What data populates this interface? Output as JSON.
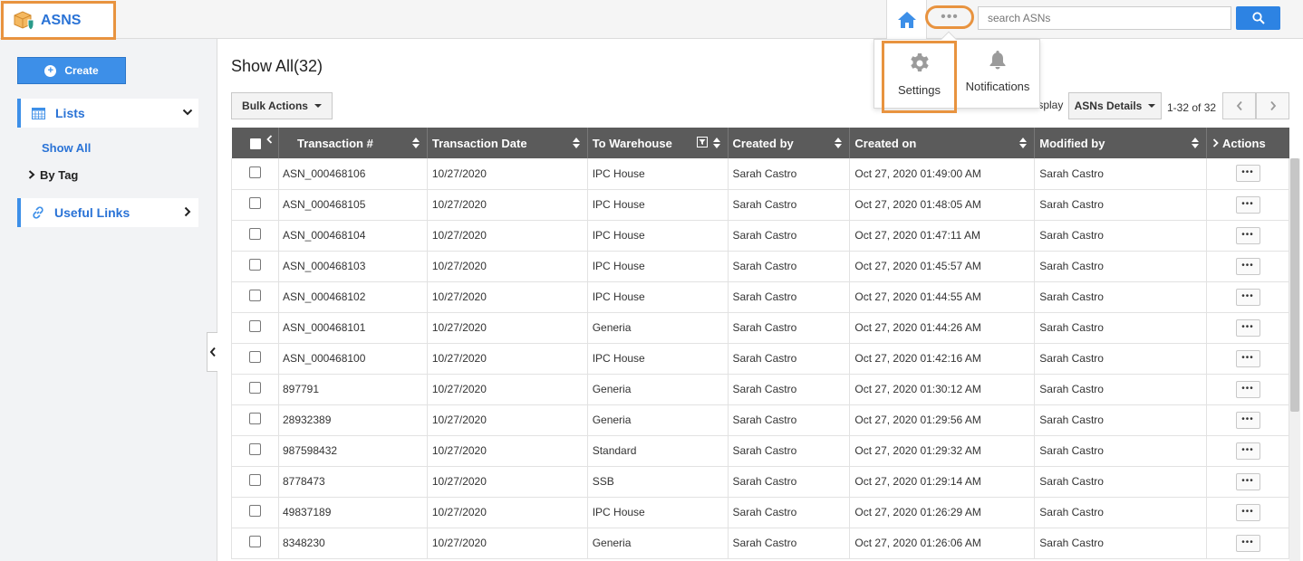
{
  "app": {
    "title": "ASNS"
  },
  "header": {
    "search_placeholder": "search ASNs",
    "more_label": "•••",
    "menu": {
      "settings": "Settings",
      "notifications": "Notifications"
    }
  },
  "sidebar": {
    "create_label": "Create",
    "lists_label": "Lists",
    "show_all_label": "Show All",
    "by_tag_label": "By Tag",
    "useful_links_label": "Useful Links"
  },
  "main": {
    "title": "Show All(32)",
    "bulk_actions_label": "Bulk Actions",
    "display_label": "Display",
    "display_value": "ASNs Details",
    "pager_text": "1-32 of 32"
  },
  "table": {
    "columns": [
      "Transaction #",
      "Transaction Date",
      "To Warehouse",
      "Created by",
      "Created on",
      "Modified by",
      "Actions"
    ],
    "rows": [
      [
        "ASN_000468106",
        "10/27/2020",
        "IPC House",
        "Sarah Castro",
        "Oct 27, 2020 01:49:00 AM",
        "Sarah Castro"
      ],
      [
        "ASN_000468105",
        "10/27/2020",
        "IPC House",
        "Sarah Castro",
        "Oct 27, 2020 01:48:05 AM",
        "Sarah Castro"
      ],
      [
        "ASN_000468104",
        "10/27/2020",
        "IPC House",
        "Sarah Castro",
        "Oct 27, 2020 01:47:11 AM",
        "Sarah Castro"
      ],
      [
        "ASN_000468103",
        "10/27/2020",
        "IPC House",
        "Sarah Castro",
        "Oct 27, 2020 01:45:57 AM",
        "Sarah Castro"
      ],
      [
        "ASN_000468102",
        "10/27/2020",
        "IPC House",
        "Sarah Castro",
        "Oct 27, 2020 01:44:55 AM",
        "Sarah Castro"
      ],
      [
        "ASN_000468101",
        "10/27/2020",
        "Generia",
        "Sarah Castro",
        "Oct 27, 2020 01:44:26 AM",
        "Sarah Castro"
      ],
      [
        "ASN_000468100",
        "10/27/2020",
        "IPC House",
        "Sarah Castro",
        "Oct 27, 2020 01:42:16 AM",
        "Sarah Castro"
      ],
      [
        "897791",
        "10/27/2020",
        "Generia",
        "Sarah Castro",
        "Oct 27, 2020 01:30:12 AM",
        "Sarah Castro"
      ],
      [
        "28932389",
        "10/27/2020",
        "Generia",
        "Sarah Castro",
        "Oct 27, 2020 01:29:56 AM",
        "Sarah Castro"
      ],
      [
        "987598432",
        "10/27/2020",
        "Standard",
        "Sarah Castro",
        "Oct 27, 2020 01:29:32 AM",
        "Sarah Castro"
      ],
      [
        "8778473",
        "10/27/2020",
        "SSB",
        "Sarah Castro",
        "Oct 27, 2020 01:29:14 AM",
        "Sarah Castro"
      ],
      [
        "49837189",
        "10/27/2020",
        "IPC House",
        "Sarah Castro",
        "Oct 27, 2020 01:26:29 AM",
        "Sarah Castro"
      ],
      [
        "8348230",
        "10/27/2020",
        "Generia",
        "Sarah Castro",
        "Oct 27, 2020 01:26:06 AM",
        "Sarah Castro"
      ]
    ],
    "row_action_label": "•••"
  },
  "colors": {
    "accent": "#2d83e3",
    "highlight": "#e8933f",
    "header_bg": "#5b5b5b"
  }
}
